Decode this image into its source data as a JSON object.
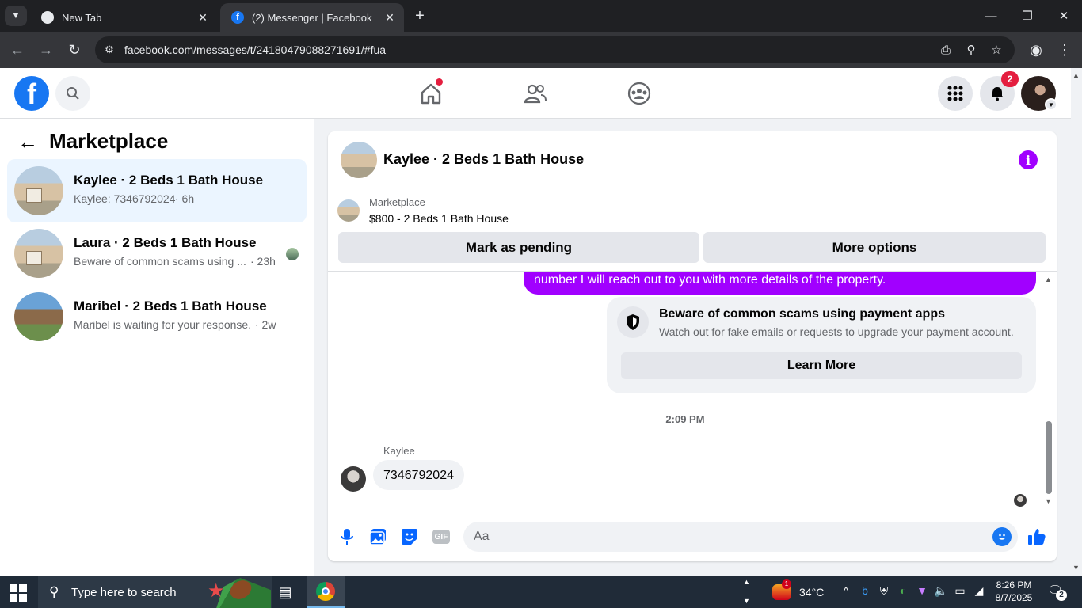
{
  "browser": {
    "tabs": [
      {
        "title": "New Tab",
        "favicon": "chrome-icon",
        "active": false
      },
      {
        "title": "(2) Messenger | Facebook",
        "favicon": "facebook-icon",
        "active": true
      }
    ],
    "url": "facebook.com/messages/t/24180479088271691/#fua",
    "new_tab_glyph": "+",
    "close_glyph": "✕"
  },
  "fb_header": {
    "logo_letter": "f",
    "notification_count": "2",
    "home_has_dot": true
  },
  "sidebar": {
    "title": "Marketplace",
    "conversations": [
      {
        "name": "Kaylee · 2 Beds 1 Bath House",
        "preview": "Kaylee: 7346792024",
        "time": "· 6h",
        "selected": true
      },
      {
        "name": "Laura · 2 Beds 1 Bath House",
        "preview": "Beware of common scams using ...",
        "time": "· 23h",
        "selected": false
      },
      {
        "name": "Maribel · 2 Beds 1 Bath House",
        "preview": "Maribel is waiting for your response.",
        "time": "· 2w",
        "selected": false
      }
    ]
  },
  "chat": {
    "title": "Kaylee · 2 Beds 1 Bath House",
    "listing": {
      "kicker": "Marketplace",
      "title": "$800 - 2 Beds 1 Bath House",
      "mark_pending_label": "Mark as pending",
      "more_options_label": "More options"
    },
    "outgoing_partial": "number  I will reach out to you with more details of the property.",
    "scam_notice": {
      "title": "Beware of common scams using payment apps",
      "body": "Watch out for fake emails or requests to upgrade your payment account.",
      "button": "Learn More"
    },
    "timestamp": "2:09 PM",
    "incoming": {
      "sender": "Kaylee",
      "text": "7346792024"
    },
    "composer": {
      "placeholder": "Aa"
    }
  },
  "taskbar": {
    "search_placeholder": "Type here to search",
    "weather": {
      "temp": "34°C",
      "badge": "1"
    },
    "clock": {
      "time": "8:26 PM",
      "date": "8/7/2025"
    },
    "notification_count": "2"
  },
  "colors": {
    "fb_blue": "#1877f2",
    "messenger_purple": "#a100ff",
    "selected_row": "#ebf5ff",
    "badge_red": "#e41e3f"
  }
}
